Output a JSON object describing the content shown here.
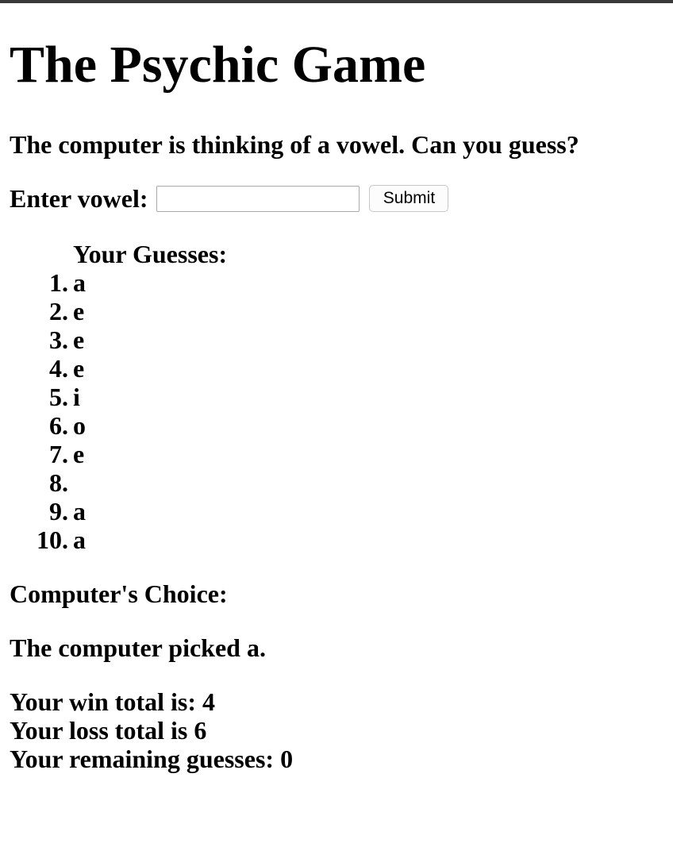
{
  "page": {
    "title": "The Psychic Game",
    "prompt": "The computer is thinking of a vowel. Can you guess?"
  },
  "form": {
    "label": "Enter vowel:",
    "input_value": "",
    "submit_label": "Submit"
  },
  "guesses": {
    "heading": "Your Guesses:",
    "items": [
      {
        "num": "1.",
        "value": "a"
      },
      {
        "num": "2.",
        "value": "e"
      },
      {
        "num": "3.",
        "value": "e"
      },
      {
        "num": "4.",
        "value": "e"
      },
      {
        "num": "5.",
        "value": "i"
      },
      {
        "num": "6.",
        "value": "o"
      },
      {
        "num": "7.",
        "value": "e"
      },
      {
        "num": "8.",
        "value": ""
      },
      {
        "num": "9.",
        "value": "a"
      },
      {
        "num": "10.",
        "value": "a"
      }
    ]
  },
  "computer": {
    "heading": "Computer's Choice:",
    "picked": "The computer picked a."
  },
  "stats": {
    "wins": "Your win total is: 4",
    "losses": "Your loss total is 6",
    "remaining": "Your remaining guesses: 0"
  }
}
